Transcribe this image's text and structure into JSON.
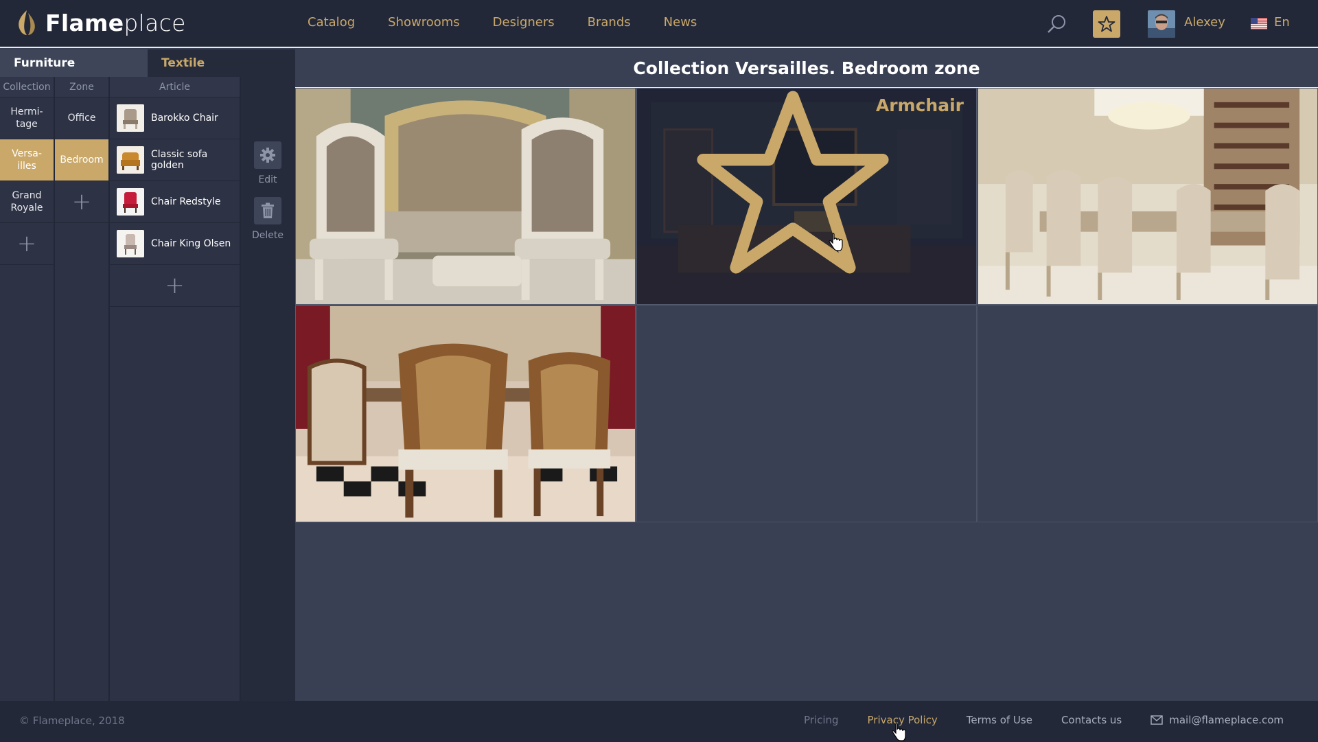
{
  "header": {
    "brand_bold": "Flame",
    "brand_light": "place",
    "nav": [
      "Catalog",
      "Showrooms",
      "Designers",
      "Brands",
      "News"
    ],
    "user_name": "Alexey",
    "language": "En"
  },
  "sidebar": {
    "tabs": [
      "Furniture",
      "Textile"
    ],
    "columns": {
      "collection": "Collection",
      "zone": "Zone",
      "article": "Article"
    },
    "collections": [
      "Hermi-\ntage",
      "Versa-\nilles",
      "Grand\nRoyale"
    ],
    "zones": [
      "Office",
      "Bedroom"
    ],
    "articles": [
      "Barokko Chair",
      "Classic sofa golden",
      "Chair Redstyle",
      "Chair King Olsen"
    ],
    "tools": {
      "edit": "Edit",
      "delete": "Delete"
    }
  },
  "main": {
    "title": "Collection Versailles. Bedroom zone",
    "hover_label": "Armchair"
  },
  "footer": {
    "copyright": "© Flameplace, 2018",
    "links": [
      "Pricing",
      "Privacy Policy",
      "Terms of Use",
      "Contacts us"
    ],
    "email": "mail@flameplace.com"
  },
  "colors": {
    "accent": "#c9a86a",
    "header_bg": "#232838",
    "main_bg": "#3a4053"
  }
}
